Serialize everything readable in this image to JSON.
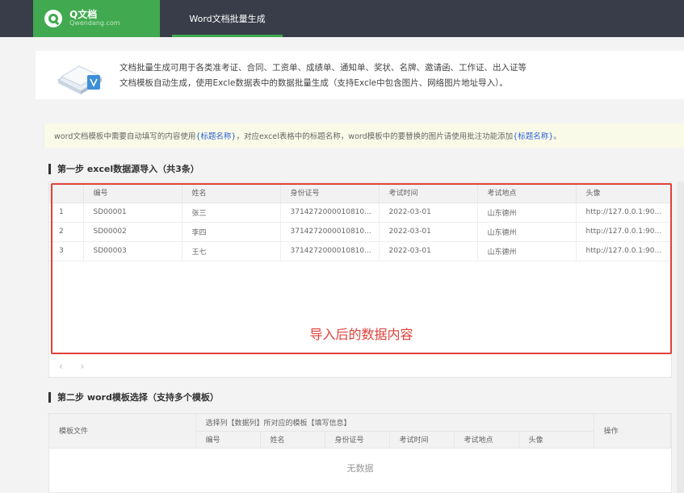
{
  "header": {
    "logo_name": "Q文档",
    "logo_domain": "Qwendang.com",
    "nav_tab": "Word文档批量生成"
  },
  "intro": {
    "line1": "文档批量生成可用于各类准考证、合同、工资单、成绩单、通知单、奖状、名牌、邀请函、工作证、出入证等",
    "line2": "文档模板自动生成，使用Excle数据表中的数据批量生成（支持Excle中包含图片、网络图片地址导入）。"
  },
  "notice": {
    "part1": "word文档模板中需要自动填写的内容使用",
    "tag1": "{标题名称}",
    "part2": "，对应excel表格中的标题名称，word模板中的要替换的图片请使用批注功能添加",
    "tag2": "{标题名称}",
    "part3": "。"
  },
  "step1": {
    "title": "第一步 excel数据源导入（共3条）",
    "columns": [
      "",
      "编号",
      "姓名",
      "身份证号",
      "考试时间",
      "考试地点",
      "头像"
    ],
    "rows": [
      [
        "1",
        "SD00001",
        "张三",
        "3714272000010810...",
        "2022-03-01",
        "山东德州",
        "http://127.0.0.1:90..."
      ],
      [
        "2",
        "SD00002",
        "李四",
        "3714272000010810...",
        "2022-03-01",
        "山东德州",
        "http://127.0.0.1:90..."
      ],
      [
        "3",
        "SD00003",
        "王七",
        "3714272000010810...",
        "2022-03-01",
        "山东德州",
        "http://127.0.0.1:90..."
      ]
    ],
    "annotation": "导入后的数据内容",
    "pager_prev": "‹",
    "pager_next": "›"
  },
  "step2": {
    "title": "第二步 word模板选择（支持多个模板）",
    "col_template": "模板文件",
    "group_header": "选择列【数据列】所对应的模板【填写信息】",
    "sub_columns": [
      "编号",
      "姓名",
      "身份证号",
      "考试时间",
      "考试地点",
      "头像"
    ],
    "col_action": "操作",
    "empty_text": "无数据"
  },
  "colors": {
    "topbar": "#393d49",
    "brand_green": "#41a94f",
    "annotation_red": "#e0413b",
    "link_blue": "#2a5fd6"
  }
}
